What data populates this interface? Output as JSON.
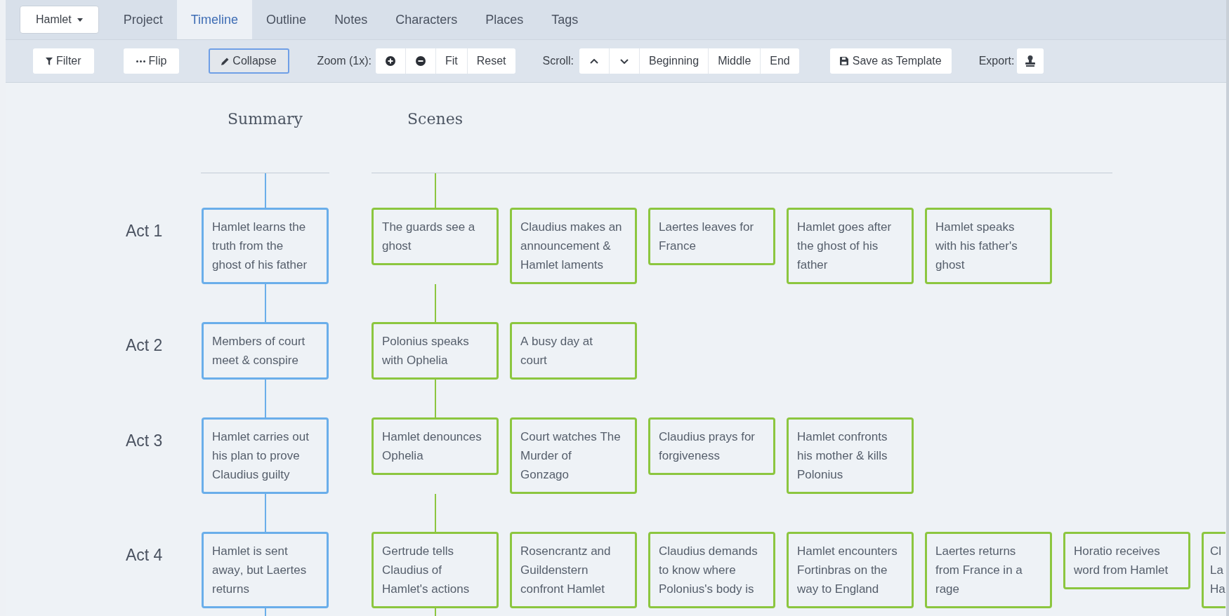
{
  "nav": {
    "project_menu": "Hamlet",
    "tabs": [
      {
        "label": "Project",
        "selected": false
      },
      {
        "label": "Timeline",
        "selected": true
      },
      {
        "label": "Outline",
        "selected": false
      },
      {
        "label": "Notes",
        "selected": false
      },
      {
        "label": "Characters",
        "selected": false
      },
      {
        "label": "Places",
        "selected": false
      },
      {
        "label": "Tags",
        "selected": false
      }
    ]
  },
  "toolbar": {
    "view_buttons": [
      {
        "label": "Filter",
        "active": false
      },
      {
        "label": "Flip",
        "active": false
      },
      {
        "label": "Collapse",
        "active": true
      }
    ],
    "zoom": {
      "label": "Zoom (1x):",
      "buttons": [
        "Fit",
        "Reset"
      ]
    },
    "scroll": {
      "label": "Scroll:",
      "buttons": [
        "Beginning",
        "Middle",
        "End"
      ]
    },
    "template_button": "Save as Template",
    "export_label": "Export:"
  },
  "timeline": {
    "columns": [
      "Summary",
      "Scenes"
    ],
    "acts": [
      {
        "label": "Act 1",
        "summary": "Hamlet learns the truth from the ghost of his father",
        "scenes": [
          "The guards see a ghost",
          "Claudius makes an announcement & Hamlet laments",
          "Laertes leaves for France",
          "Hamlet goes after the ghost of his father",
          "Hamlet speaks with his father's ghost"
        ]
      },
      {
        "label": "Act 2",
        "summary": "Members of court meet & conspire",
        "scenes": [
          "Polonius speaks with Ophelia",
          "A busy day at court"
        ]
      },
      {
        "label": "Act 3",
        "summary": "Hamlet carries out his plan to prove Claudius guilty",
        "scenes": [
          "Hamlet denounces Ophelia",
          "Court watches The Murder of Gonzago",
          "Claudius prays for forgiveness",
          "Hamlet confronts his mother & kills Polonius"
        ]
      },
      {
        "label": "Act 4",
        "summary": "Hamlet is sent away, but Laertes returns",
        "scenes": [
          "Gertrude tells Claudius of Hamlet's actions",
          "Rosencrantz and Guildenstern confront Hamlet",
          "Claudius demands to know where Polonius's body is",
          "Hamlet encounters Fortinbras on the way to England",
          "Laertes returns from France in a rage",
          "Horatio receives word from Hamlet"
        ],
        "cut_off_scene": "Cl La Ha"
      }
    ]
  }
}
